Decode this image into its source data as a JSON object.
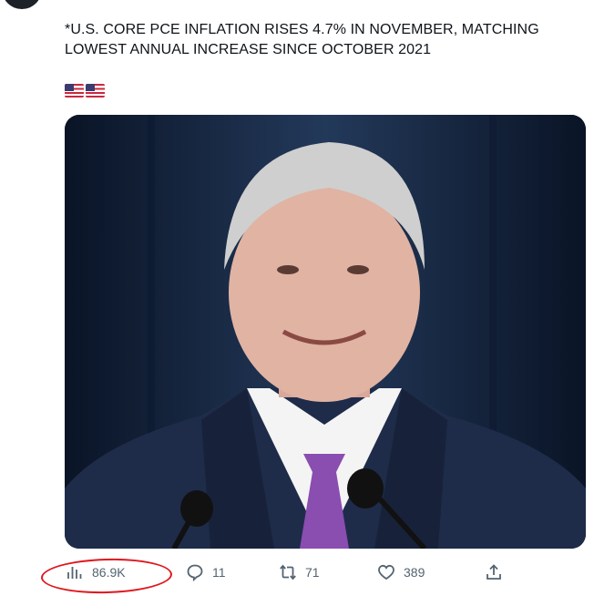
{
  "tweet": {
    "text": "*U.S. CORE PCE INFLATION RISES 4.7% IN NOVEMBER, MATCHING\nLOWEST ANNUAL INCREASE SINCE OCTOBER 2021",
    "flags": [
      "us-flag",
      "us-flag"
    ]
  },
  "actions": {
    "views": "86.9K",
    "replies": "11",
    "retweets": "71",
    "likes": "389"
  },
  "colors": {
    "icon": "#536471",
    "annotation": "#e0161e"
  }
}
